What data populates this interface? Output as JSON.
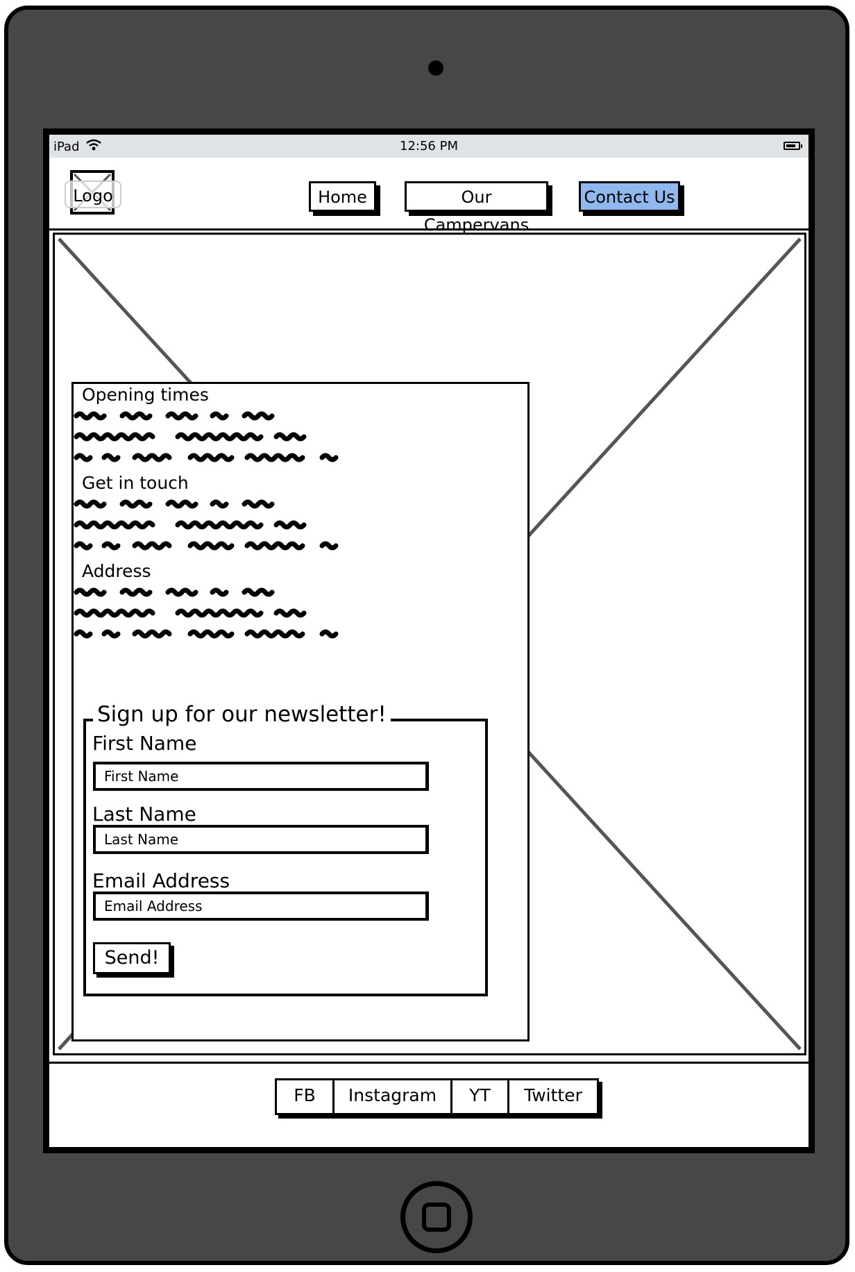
{
  "status_bar": {
    "device": "iPad",
    "time": "12:56 PM"
  },
  "header": {
    "logo_label": "Logo",
    "nav": {
      "home": "Home",
      "campervans": "Our Campervans",
      "contact": "Contact Us"
    },
    "active_nav": "Contact Us",
    "active_color": "#90b8ef"
  },
  "hero": {
    "image": "placeholder-image"
  },
  "info_panel": {
    "sections": [
      {
        "title": "Opening times"
      },
      {
        "title": "Get in touch"
      },
      {
        "title": "Address"
      }
    ]
  },
  "newsletter": {
    "legend": "Sign up for our newsletter!",
    "first_name": {
      "label": "First Name",
      "placeholder": "First Name"
    },
    "last_name": {
      "label": "Last Name",
      "placeholder": "Last Name"
    },
    "email": {
      "label": "Email Address",
      "placeholder": "Email Address"
    },
    "submit_label": "Send!"
  },
  "footer": {
    "social": {
      "fb": "FB",
      "instagram": "Instagram",
      "yt": "YT",
      "twitter": "Twitter"
    }
  },
  "icons": {
    "wifi": "wifi-icon",
    "battery": "battery-icon",
    "camera": "camera-icon",
    "home": "home-button-icon"
  }
}
